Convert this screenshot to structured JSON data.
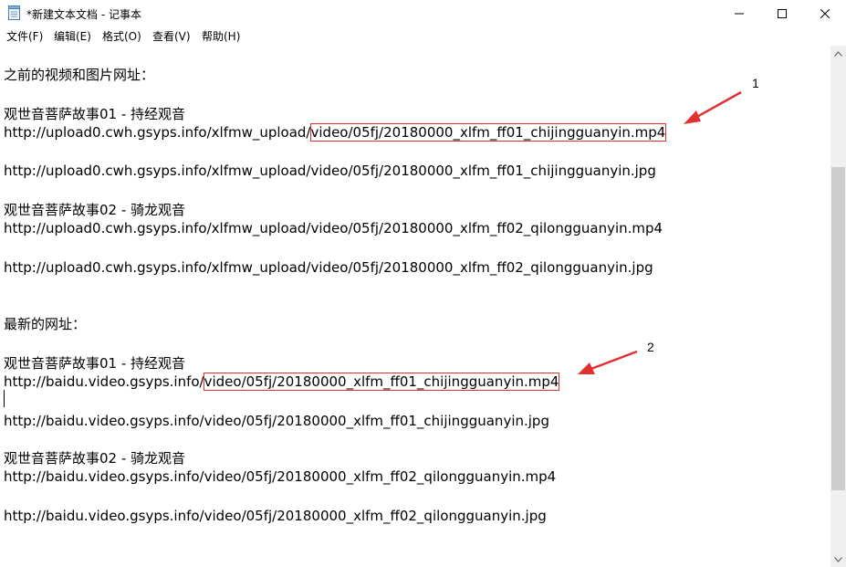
{
  "window": {
    "title": "*新建文本文档 - 记事本",
    "icon": "notepad-icon"
  },
  "menu": {
    "items": [
      "文件(F)",
      "编辑(E)",
      "格式(O)",
      "查看(V)",
      "帮助(H)"
    ]
  },
  "content": {
    "lines": [
      "之前的视频和图片网址：",
      "观世音菩萨故事01 - 持经观音",
      "http://upload0.cwh.gsyps.info/xlfmw_upload/",
      "video/05fj/20180000_xlfm_ff01_chijingguanyin.mp4",
      "http://upload0.cwh.gsyps.info/xlfmw_upload/video/05fj/20180000_xlfm_ff01_chijingguanyin.jpg",
      "观世音菩萨故事02 - 骑龙观音",
      "http://upload0.cwh.gsyps.info/xlfmw_upload/video/05fj/20180000_xlfm_ff02_qilongguanyin.mp4",
      "http://upload0.cwh.gsyps.info/xlfmw_upload/video/05fj/20180000_xlfm_ff02_qilongguanyin.jpg",
      "最新的网址：",
      "观世音菩萨故事01 - 持经观音",
      "http://baidu.video.gsyps.info/",
      "video/05fj/20180000_xlfm_ff01_chijingguanyin.mp4",
      "http://baidu.video.gsyps.info/video/05fj/20180000_xlfm_ff01_chijingguanyin.jpg",
      "观世音菩萨故事02 - 骑龙观音",
      "http://baidu.video.gsyps.info/video/05fj/20180000_xlfm_ff02_qilongguanyin.mp4",
      "http://baidu.video.gsyps.info/video/05fj/20180000_xlfm_ff02_qilongguanyin.jpg"
    ]
  },
  "annotations": {
    "label1": "1",
    "label2": "2",
    "color": "#e03131"
  }
}
